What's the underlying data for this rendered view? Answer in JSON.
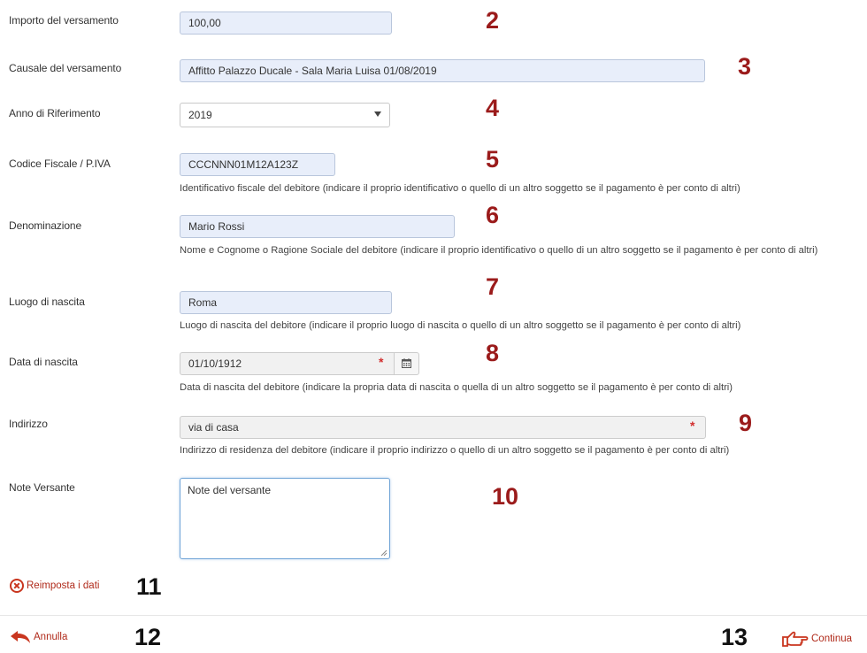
{
  "form": {
    "importo": {
      "label": "Importo del versamento",
      "value": "100,00",
      "marker": "2"
    },
    "causale": {
      "label": "Causale del versamento",
      "value": "Affitto Palazzo Ducale - Sala Maria Luisa 01/08/2019",
      "marker": "3"
    },
    "anno": {
      "label": "Anno di Riferimento",
      "value": "2019",
      "marker": "4"
    },
    "codice_fiscale": {
      "label": "Codice Fiscale / P.IVA",
      "value": "CCCNNN01M12A123Z",
      "help": "Identificativo fiscale del debitore (indicare il proprio identificativo o quello di un altro soggetto se il pagamento è per conto di altri)",
      "marker": "5"
    },
    "denominazione": {
      "label": "Denominazione",
      "value": "Mario Rossi",
      "help": "Nome e Cognome o Ragione Sociale del debitore (indicare il proprio identificativo o quello di un altro soggetto se il pagamento è per conto di altri)",
      "marker": "6"
    },
    "luogo_nascita": {
      "label": "Luogo di nascita",
      "value": "Roma",
      "help": "Luogo di nascita del debitore (indicare il proprio luogo di nascita o quello di un altro soggetto se il pagamento è per conto di altri)",
      "marker": "7"
    },
    "data_nascita": {
      "label": "Data di nascita",
      "value": "01/10/1912",
      "help": "Data di nascita del debitore (indicare la propria data di nascita o quella di un altro soggetto se il pagamento è per conto di altri)",
      "marker": "8"
    },
    "indirizzo": {
      "label": "Indirizzo",
      "value": "via di casa",
      "help": "Indirizzo di residenza del debitore (indicare il proprio indirizzo o quello di un altro soggetto se il pagamento è per conto di altri)",
      "marker": "9"
    },
    "note": {
      "label": "Note Versante",
      "value": "Note del versante",
      "marker": "10"
    },
    "required_mark": "*"
  },
  "actions": {
    "reset_label": "Reimposta i dati",
    "reset_marker": "11",
    "cancel_label": "Annulla",
    "cancel_marker": "12",
    "continue_label": "Continua",
    "continue_marker": "13"
  },
  "colors": {
    "accent": "#b02a1a",
    "marker_red": "#9b1b1b",
    "field_blue": "#e8eefa"
  }
}
